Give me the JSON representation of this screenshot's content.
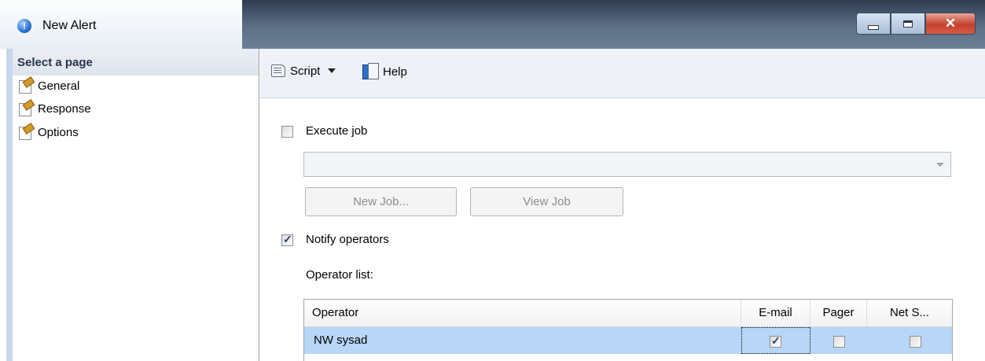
{
  "window": {
    "title": "New Alert"
  },
  "sidebar": {
    "header": "Select a page",
    "items": [
      {
        "label": "General"
      },
      {
        "label": "Response"
      },
      {
        "label": "Options"
      }
    ]
  },
  "toolbar": {
    "script_label": "Script",
    "help_label": "Help"
  },
  "response": {
    "execute_job_label": "Execute job",
    "execute_job_checked": false,
    "job_combo_value": "",
    "new_job_label": "New Job...",
    "view_job_label": "View Job",
    "notify_operators_label": "Notify operators",
    "notify_operators_checked": true,
    "operator_list_label": "Operator list:"
  },
  "operator_grid": {
    "columns": [
      "Operator",
      "E-mail",
      "Pager",
      "Net S..."
    ],
    "rows": [
      {
        "operator": "NW sysad",
        "email": true,
        "pager": false,
        "net_send": false
      }
    ]
  }
}
